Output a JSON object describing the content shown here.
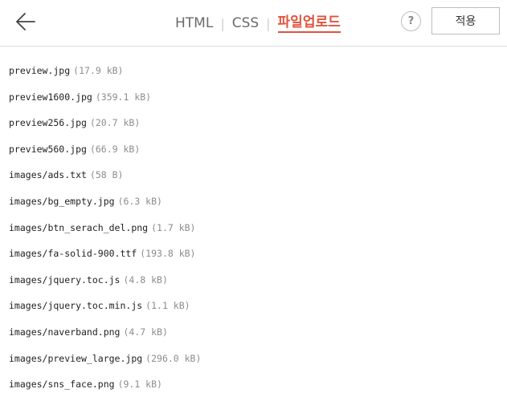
{
  "header": {
    "tabs": [
      {
        "label": "HTML",
        "active": false
      },
      {
        "label": "CSS",
        "active": false
      },
      {
        "label": "파일업로드",
        "active": true
      }
    ],
    "tab_separator": "|",
    "help_label": "?",
    "apply_label": "적용"
  },
  "colors": {
    "accent": "#e0543e",
    "text": "#222222",
    "muted": "#8c8c8c",
    "border": "#dcdcdc"
  },
  "icons": {
    "back": "arrow-left-icon"
  },
  "files": [
    {
      "name": "preview.jpg",
      "size": "(17.9 kB)"
    },
    {
      "name": "preview1600.jpg",
      "size": "(359.1 kB)"
    },
    {
      "name": "preview256.jpg",
      "size": "(20.7 kB)"
    },
    {
      "name": "preview560.jpg",
      "size": "(66.9 kB)"
    },
    {
      "name": "images/ads.txt",
      "size": "(58 B)"
    },
    {
      "name": "images/bg_empty.jpg",
      "size": "(6.3 kB)"
    },
    {
      "name": "images/btn_serach_del.png",
      "size": "(1.7 kB)"
    },
    {
      "name": "images/fa-solid-900.ttf",
      "size": "(193.8 kB)"
    },
    {
      "name": "images/jquery.toc.js",
      "size": "(4.8 kB)"
    },
    {
      "name": "images/jquery.toc.min.js",
      "size": "(1.1 kB)"
    },
    {
      "name": "images/naverband.png",
      "size": "(4.7 kB)"
    },
    {
      "name": "images/preview_large.jpg",
      "size": "(296.0 kB)"
    },
    {
      "name": "images/sns_face.png",
      "size": "(9.1 kB)"
    }
  ]
}
